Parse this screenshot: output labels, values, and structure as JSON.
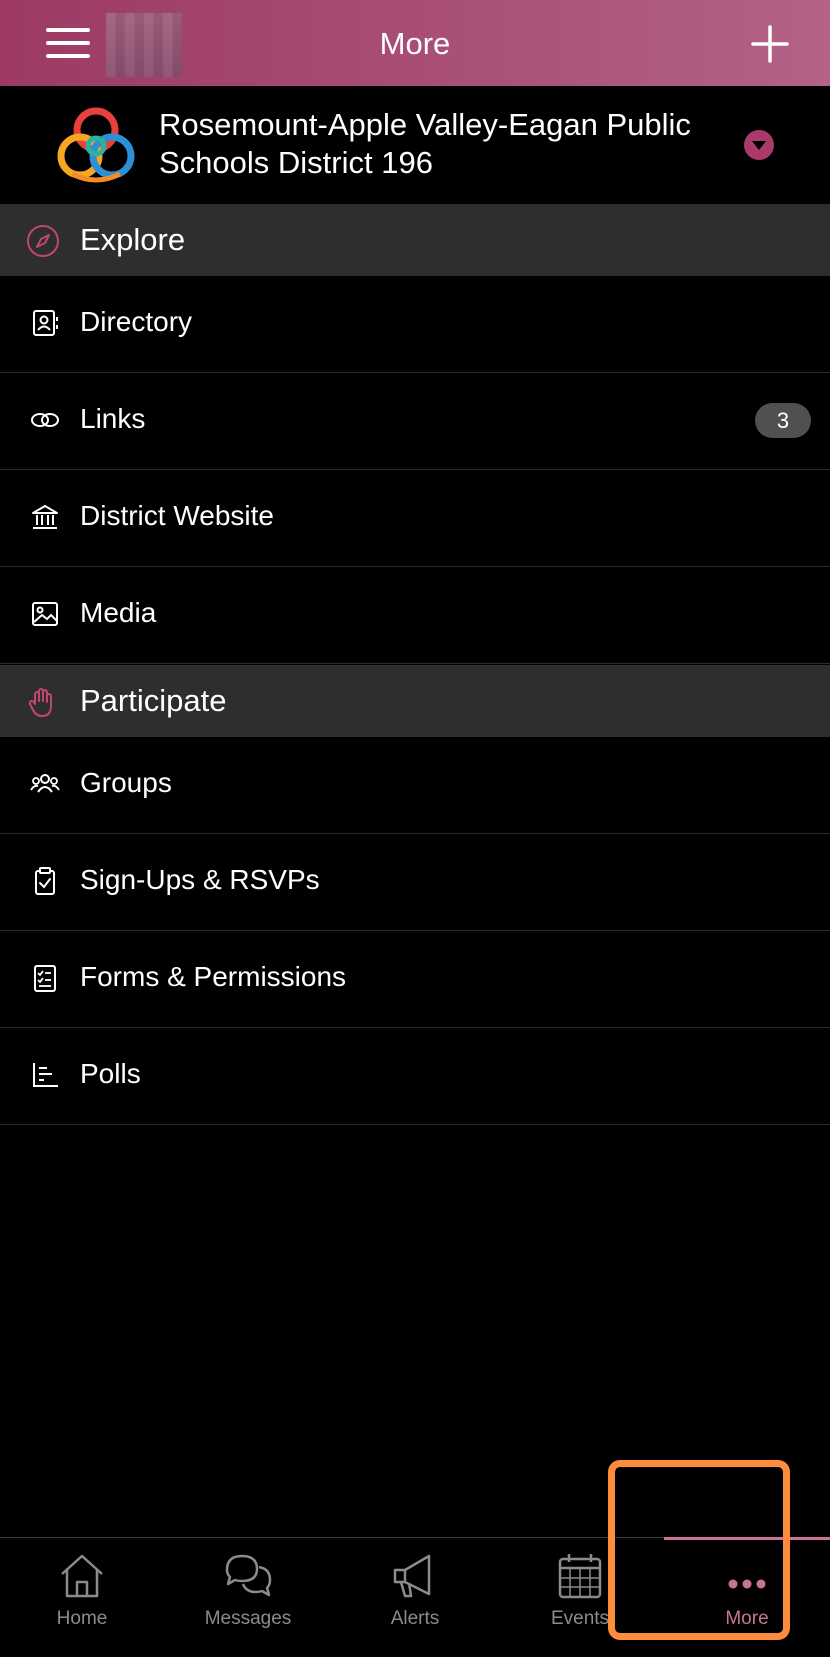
{
  "header": {
    "title": "More",
    "menu_icon": "hamburger-menu-icon",
    "add_icon": "plus-icon"
  },
  "organization": {
    "name": "Rosemount-Apple Valley-Eagan Public Schools District 196",
    "logo_icon": "district-logo",
    "dropdown_icon": "chevron-down-icon"
  },
  "sections": [
    {
      "label": "Explore",
      "icon": "compass-icon",
      "items": [
        {
          "label": "Directory",
          "icon": "contact-card-icon"
        },
        {
          "label": "Links",
          "icon": "link-icon",
          "badge": "3"
        },
        {
          "label": "District Website",
          "icon": "bank-building-icon"
        },
        {
          "label": "Media",
          "icon": "image-icon"
        }
      ]
    },
    {
      "label": "Participate",
      "icon": "raised-hand-icon",
      "items": [
        {
          "label": "Groups",
          "icon": "people-icon"
        },
        {
          "label": "Sign-Ups & RSVPs",
          "icon": "clipboard-check-icon"
        },
        {
          "label": "Forms & Permissions",
          "icon": "checklist-icon"
        },
        {
          "label": "Polls",
          "icon": "bar-chart-icon"
        }
      ]
    }
  ],
  "tabbar": {
    "active": "More",
    "tabs": [
      {
        "label": "Home",
        "icon": "home-icon"
      },
      {
        "label": "Messages",
        "icon": "chat-bubbles-icon"
      },
      {
        "label": "Alerts",
        "icon": "megaphone-icon"
      },
      {
        "label": "Events",
        "icon": "calendar-icon"
      },
      {
        "label": "More",
        "icon": "more-dots-icon"
      }
    ]
  },
  "colors": {
    "header_start": "#9c3a64",
    "header_end": "#b46288",
    "accent": "#c9739b",
    "section_bg": "#2e2e30",
    "highlight": "#ff8c3a"
  }
}
